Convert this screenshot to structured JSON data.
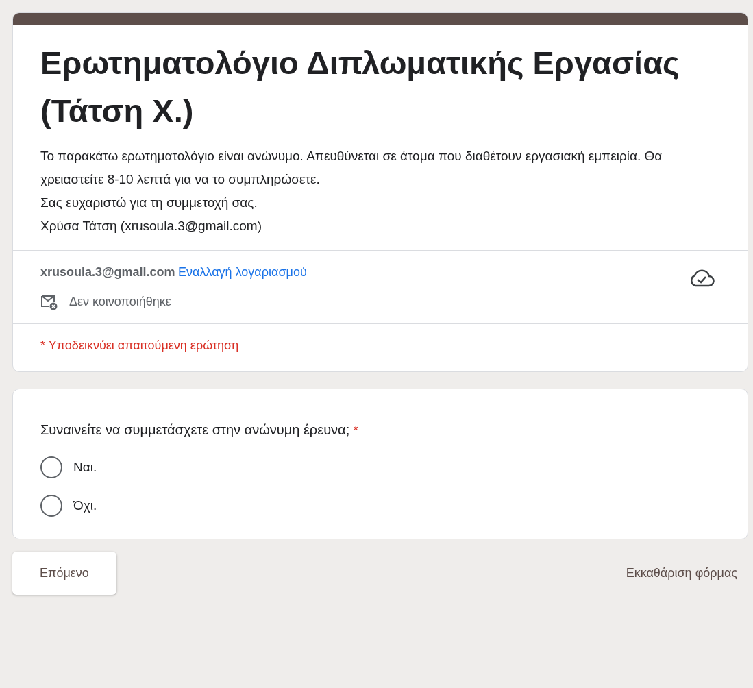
{
  "header": {
    "title": "Ερωτηματολόγιο Διπλωματικής Εργασίας (Τάτση Χ.)",
    "description": [
      "Το παρακάτω ερωτηματολόγιο είναι ανώνυμο. Απευθύνεται σε άτομα που διαθέτουν εργασιακή εμπειρία. Θα χρειαστείτε 8-10 λεπτά για να το συμπληρώσετε.",
      "Σας ευχαριστώ για τη συμμετοχή σας.",
      "Χρύσα Τάτση (xrusoula.3@gmail.com)"
    ],
    "account": {
      "email": "xrusoula.3@gmail.com",
      "switch_link": "Εναλλαγή λογαριασμού",
      "share_status": "Δεν κοινοποιήθηκε"
    },
    "required_note": "* Υποδεικνύει απαιτούμενη ερώτηση"
  },
  "question": {
    "text": "Συναινείτε να συμμετάσχετε στην ανώνυμη έρευνα;",
    "required_mark": "*",
    "options": [
      {
        "label": "Ναι.",
        "selected": false
      },
      {
        "label": "Όχι.",
        "selected": false
      }
    ]
  },
  "footer": {
    "next_button": "Επόμενο",
    "clear_link": "Εκκαθάριση φόρμας"
  }
}
